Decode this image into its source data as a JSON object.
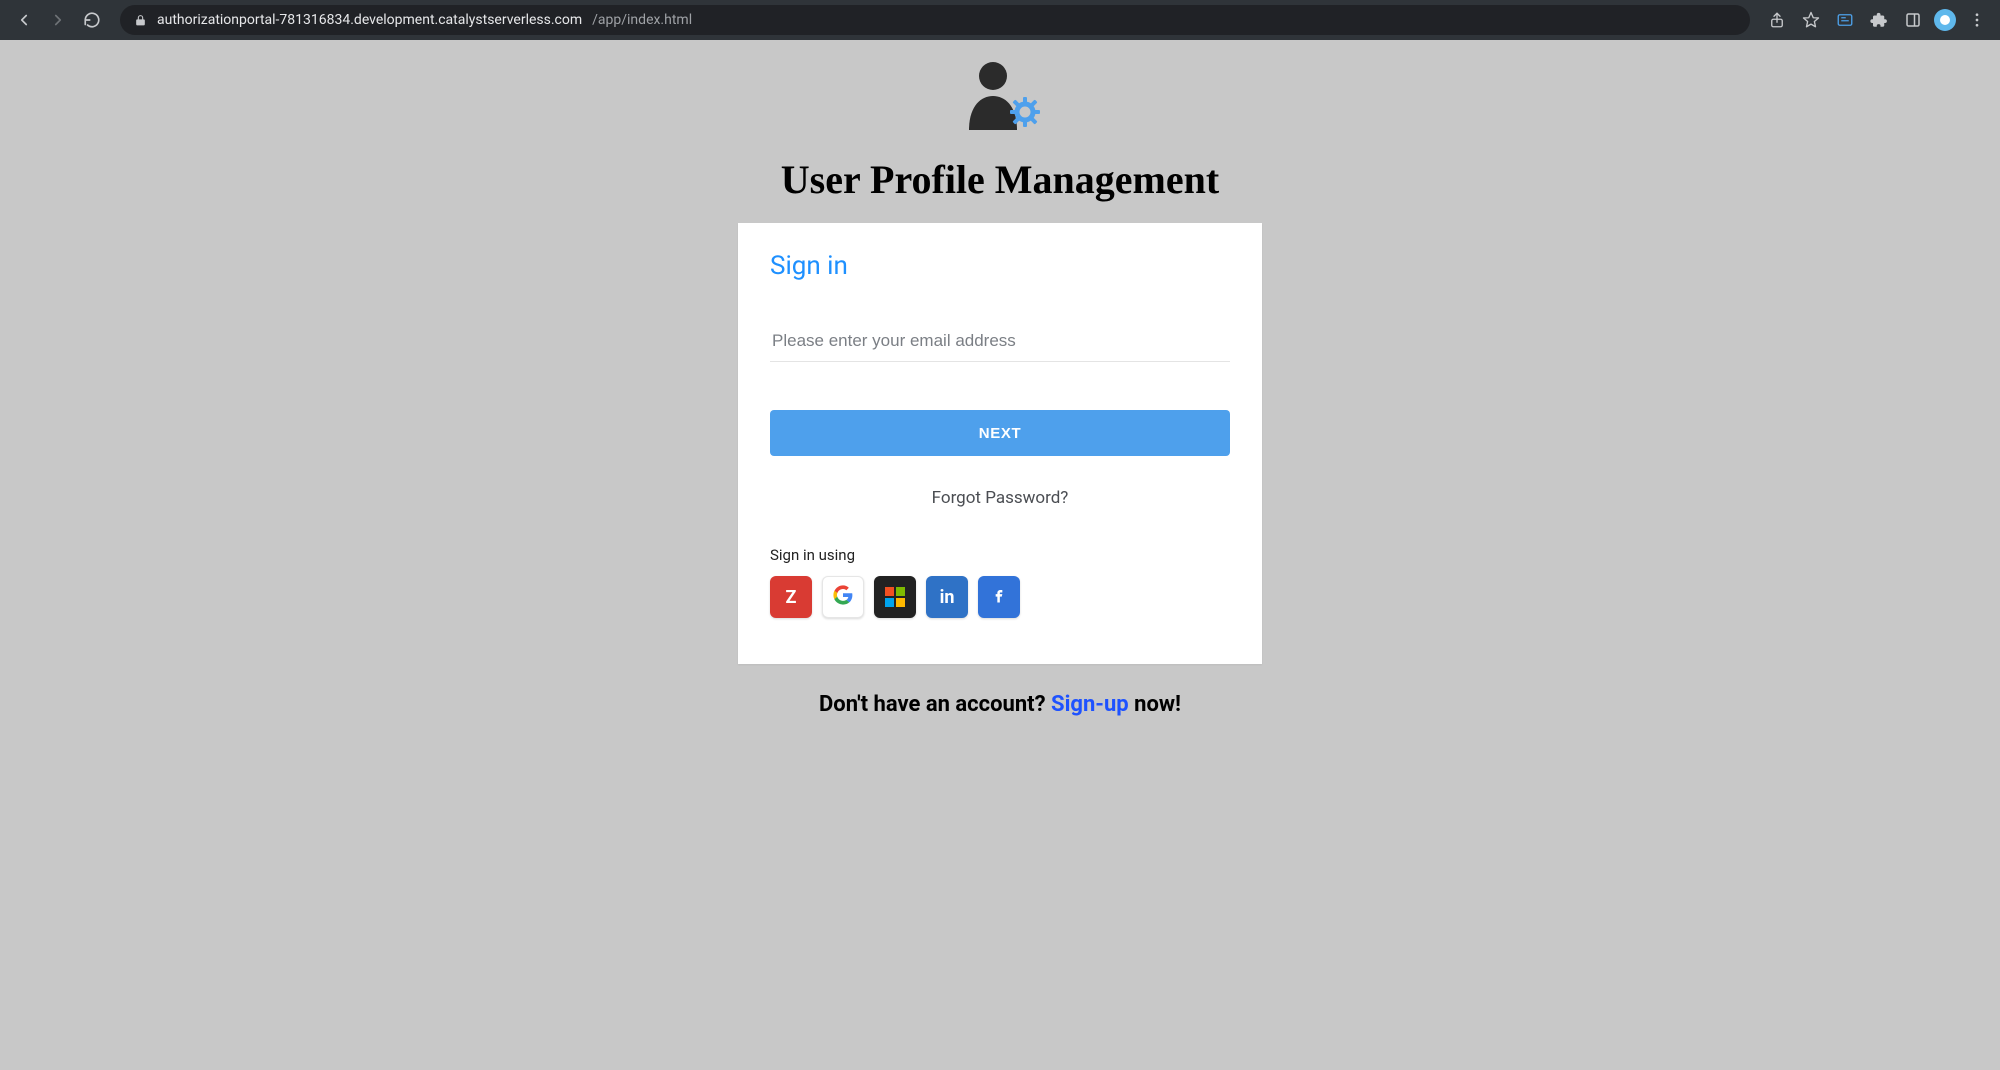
{
  "browser": {
    "url_host": "authorizationportal-781316834.development.catalystserverless.com",
    "url_path": "/app/index.html"
  },
  "page": {
    "title": "User Profile Management"
  },
  "signin": {
    "heading": "Sign in",
    "email_placeholder": "Please enter your email address",
    "next_label": "NEXT",
    "forgot_label": "Forgot Password?",
    "social_label": "Sign in using",
    "providers": {
      "zoho": "Z",
      "google": "G",
      "microsoft": "Microsoft",
      "linkedin": "in",
      "facebook": "f"
    }
  },
  "signup": {
    "prefix": "Don't have an account? ",
    "link": "Sign-up",
    "suffix": " now!"
  }
}
